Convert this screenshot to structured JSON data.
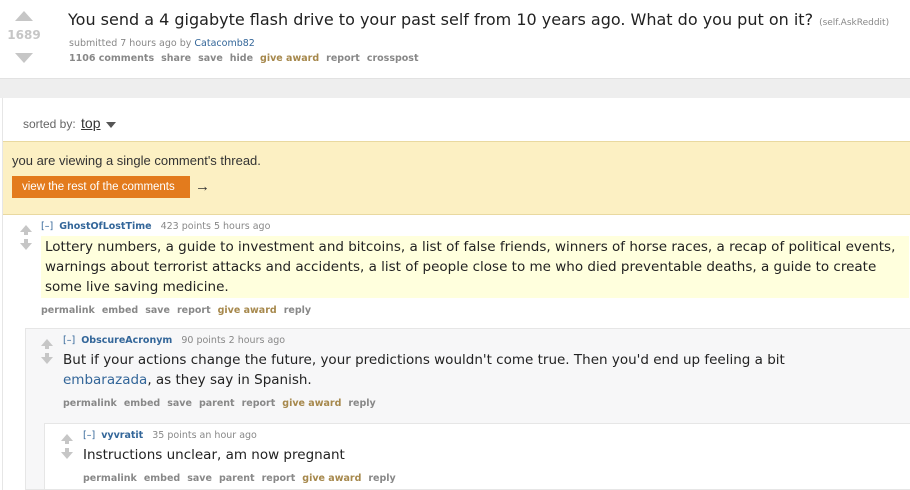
{
  "post": {
    "score": "1689",
    "title": "You send a 4 gigabyte flash drive to your past self from 10 years ago. What do you put on it?",
    "domain": "(self.AskReddit)",
    "submitted_prefix": "submitted 7 hours ago by",
    "author": "Catacomb82",
    "buttons": [
      "1106 comments",
      "share",
      "save",
      "hide",
      "give award",
      "report",
      "crosspost"
    ]
  },
  "sort": {
    "label": "sorted by:",
    "value": "top"
  },
  "banner": {
    "text": "you are viewing a single comment's thread.",
    "button": "view the rest of the comments",
    "arrow": "→"
  },
  "comments": [
    {
      "collapse": "[–]",
      "author": "GhostOfLostTime",
      "meta": "423 points 5 hours ago",
      "body": "Lottery numbers, a guide to investment and bitcoins, a list of false friends, winners of horse races, a recap of political events, warnings about terrorist attacks and accidents, a list of people close to me who died preventable deaths, a guide to create some live saving medicine.",
      "buttons": [
        "permalink",
        "embed",
        "save",
        "report",
        "give award",
        "reply"
      ]
    },
    {
      "collapse": "[–]",
      "author": "ObscureAcronym",
      "meta": "90 points 2 hours ago",
      "body_before": "But if your actions change the future, your predictions wouldn't come true. Then you'd end up feeling a bit",
      "body_link": "embarazada",
      "body_after": ", as they say in Spanish.",
      "buttons": [
        "permalink",
        "embed",
        "save",
        "parent",
        "report",
        "give award",
        "reply"
      ]
    },
    {
      "collapse": "[–]",
      "author": "vyvratit",
      "meta": "35 points an hour ago",
      "body": "Instructions unclear, am now pregnant",
      "buttons": [
        "permalink",
        "embed",
        "save",
        "parent",
        "report",
        "give award",
        "reply"
      ]
    }
  ],
  "colors": {
    "banner_bg": "#fcf0c3",
    "banner_button": "#e37b1d",
    "highlight": "#ffffdd",
    "link": "#336699",
    "award": "#a6884c"
  }
}
